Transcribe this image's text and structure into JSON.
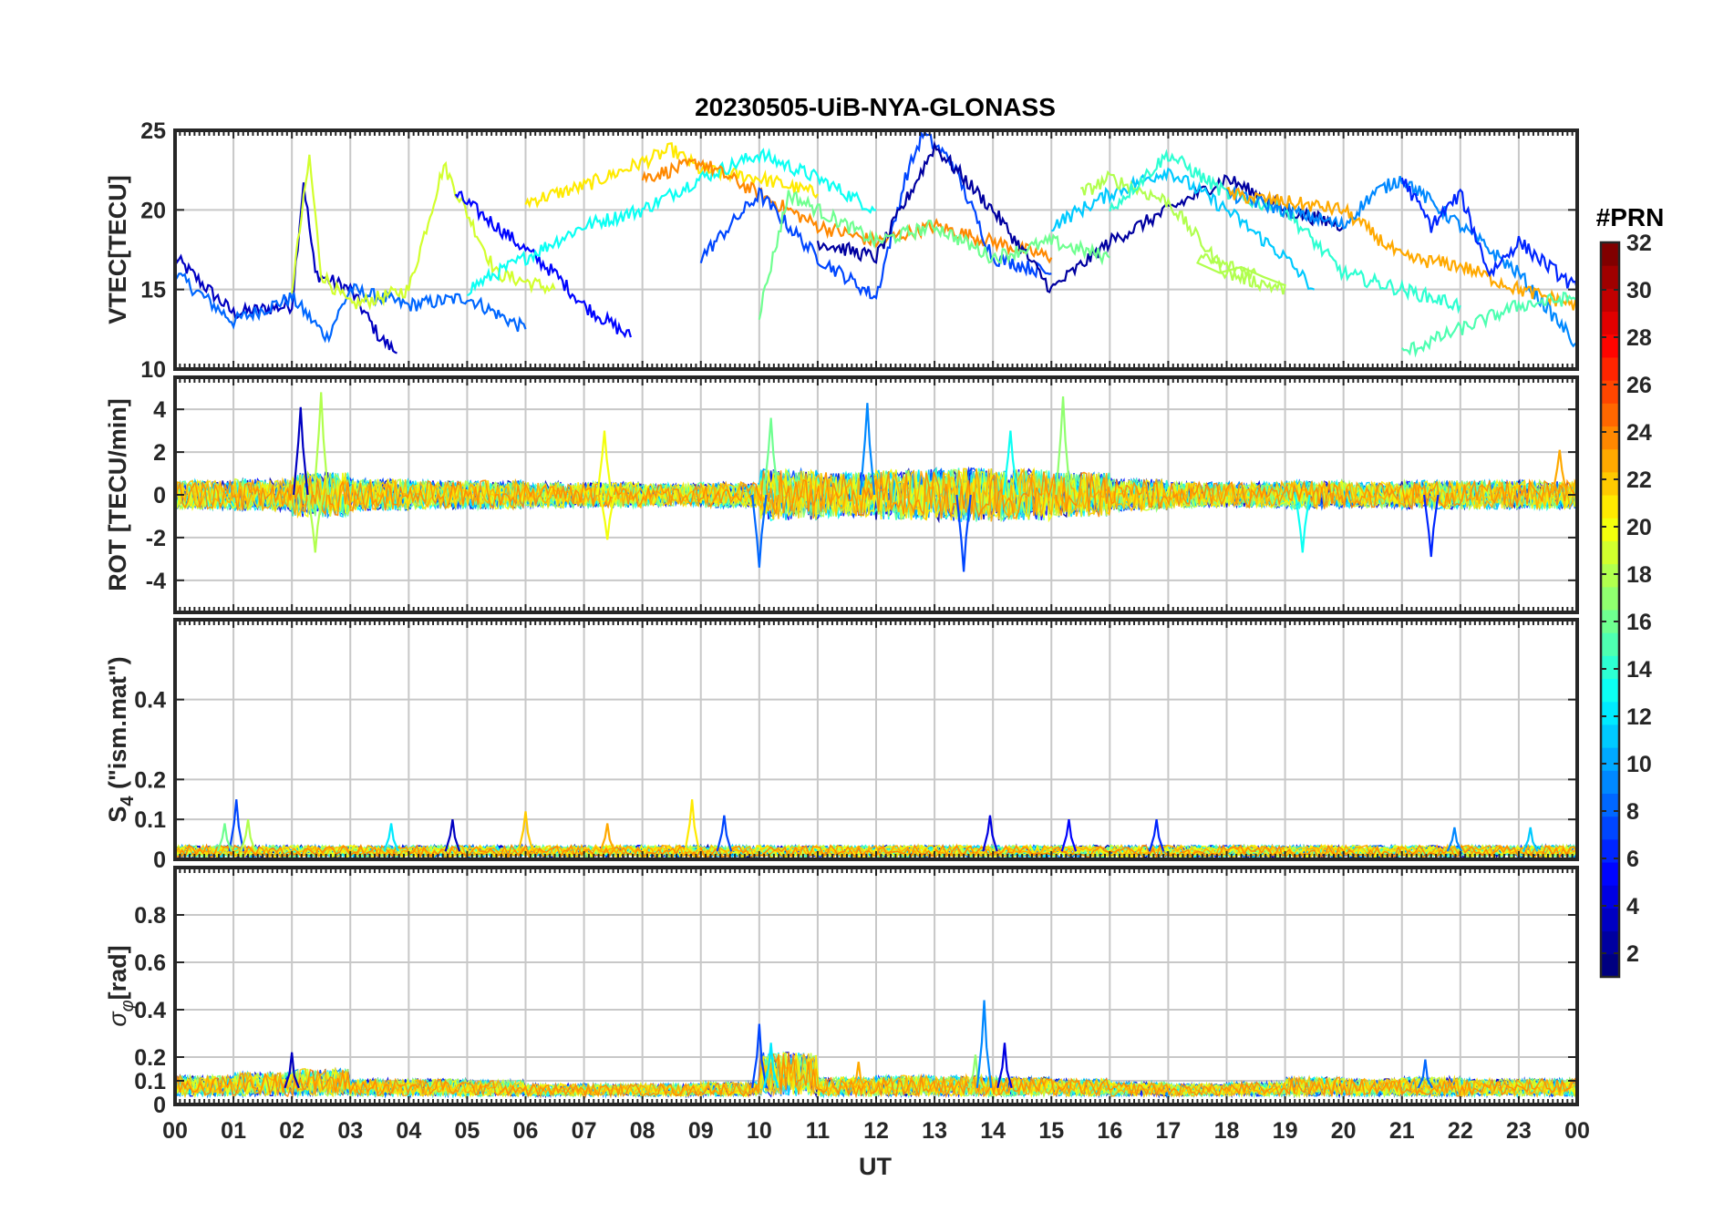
{
  "chart_data": {
    "title": "20230505-UiB-NYA-GLONASS",
    "type": "line",
    "x_axis": {
      "label": "UT",
      "ticks": [
        "00",
        "01",
        "02",
        "03",
        "04",
        "05",
        "06",
        "07",
        "08",
        "09",
        "10",
        "11",
        "12",
        "13",
        "14",
        "15",
        "16",
        "17",
        "18",
        "19",
        "20",
        "21",
        "22",
        "23",
        "00"
      ],
      "range_hours": [
        0,
        24
      ]
    },
    "grid": true,
    "color_by": "PRN",
    "colorbar": {
      "title": "#PRN",
      "colormap": "jet",
      "range": [
        1,
        32
      ],
      "levels": 32,
      "placement": "right",
      "ticks": [
        "2",
        "4",
        "6",
        "8",
        "10",
        "12",
        "14",
        "16",
        "18",
        "20",
        "22",
        "24",
        "26",
        "28",
        "30",
        "32"
      ]
    },
    "panels": [
      {
        "id": "vtec",
        "ylabel": "VTEC[TECU]",
        "ylim": [
          10,
          25
        ],
        "yticks": [
          "10",
          "15",
          "20",
          "25"
        ],
        "ytick_values": [
          10,
          15,
          20,
          25
        ],
        "series": [
          {
            "prn": 3,
            "points": [
              [
                0,
                17
              ],
              [
                1,
                13.5
              ],
              [
                2,
                14
              ],
              [
                2.2,
                21.8
              ],
              [
                2.4,
                16
              ],
              [
                3,
                15
              ],
              [
                3.5,
                12
              ],
              [
                3.8,
                11
              ]
            ]
          },
          {
            "prn": 8,
            "points": [
              [
                0,
                16
              ],
              [
                1,
                13
              ],
              [
                2,
                14.5
              ],
              [
                2.6,
                12
              ],
              [
                3,
                15
              ],
              [
                4,
                14
              ],
              [
                5,
                14.5
              ],
              [
                6,
                12.5
              ]
            ]
          },
          {
            "prn": 19,
            "points": [
              [
                2,
                15
              ],
              [
                2.3,
                23.3
              ],
              [
                2.5,
                16
              ],
              [
                3,
                14
              ],
              [
                4,
                15
              ],
              [
                4.6,
                22.8
              ],
              [
                5.5,
                16
              ],
              [
                6.5,
                15
              ]
            ]
          },
          {
            "prn": 5,
            "points": [
              [
                4.8,
                21
              ],
              [
                5.5,
                19
              ],
              [
                6.5,
                16
              ],
              [
                7,
                14
              ],
              [
                7.8,
                12
              ]
            ]
          },
          {
            "prn": 21,
            "points": [
              [
                6,
                20.5
              ],
              [
                7,
                21.5
              ],
              [
                8,
                23
              ],
              [
                8.5,
                23.8
              ],
              [
                9,
                22.5
              ],
              [
                10,
                22
              ],
              [
                11,
                21
              ]
            ]
          },
          {
            "prn": 13,
            "points": [
              [
                5,
                15
              ],
              [
                6,
                17
              ],
              [
                7,
                19
              ],
              [
                8,
                20
              ],
              [
                9,
                22
              ],
              [
                10,
                23.5
              ],
              [
                11,
                22
              ],
              [
                12,
                20
              ]
            ]
          },
          {
            "prn": 24,
            "points": [
              [
                8,
                22
              ],
              [
                9,
                23
              ],
              [
                10,
                21
              ],
              [
                11,
                19
              ],
              [
                12,
                18
              ],
              [
                13,
                19
              ],
              [
                14,
                18
              ],
              [
                15,
                17
              ]
            ]
          },
          {
            "prn": 7,
            "points": [
              [
                9,
                17
              ],
              [
                10,
                21
              ],
              [
                11,
                17
              ],
              [
                12,
                14.5
              ],
              [
                12.5,
                22
              ],
              [
                12.8,
                24.8
              ],
              [
                13.3,
                23
              ],
              [
                14,
                17
              ],
              [
                15,
                16
              ]
            ]
          },
          {
            "prn": 2,
            "points": [
              [
                11,
                18
              ],
              [
                12,
                17
              ],
              [
                13,
                24
              ],
              [
                14,
                20
              ],
              [
                15,
                15
              ],
              [
                16,
                18
              ],
              [
                17,
                20
              ],
              [
                18,
                22
              ],
              [
                19,
                20
              ],
              [
                20,
                19
              ]
            ]
          },
          {
            "prn": 16,
            "points": [
              [
                10,
                13.5
              ],
              [
                10.5,
                21
              ],
              [
                11,
                20
              ],
              [
                12,
                18
              ],
              [
                13,
                19
              ],
              [
                14,
                17
              ],
              [
                15,
                18
              ],
              [
                16,
                17
              ]
            ]
          },
          {
            "prn": 11,
            "points": [
              [
                15,
                19
              ],
              [
                16,
                21
              ],
              [
                17,
                22.5
              ],
              [
                18,
                20
              ],
              [
                19,
                17
              ],
              [
                19.5,
                15
              ]
            ]
          },
          {
            "prn": 18,
            "points": [
              [
                15.5,
                21
              ],
              [
                16,
                22
              ],
              [
                17,
                20.5
              ],
              [
                18,
                16
              ],
              [
                19,
                15
              ],
              [
                17.5,
                17
              ],
              [
                18.5,
                16
              ]
            ]
          },
          {
            "prn": 14,
            "points": [
              [
                16,
                20
              ],
              [
                17,
                23.5
              ],
              [
                18,
                21
              ],
              [
                19,
                20
              ],
              [
                20,
                16
              ],
              [
                21,
                15
              ],
              [
                22,
                14
              ]
            ]
          },
          {
            "prn": 9,
            "points": [
              [
                18,
                21
              ],
              [
                19,
                20
              ],
              [
                20,
                19
              ],
              [
                20.5,
                21
              ],
              [
                21,
                22
              ],
              [
                22,
                19
              ],
              [
                23,
                16
              ],
              [
                24,
                11.5
              ]
            ]
          },
          {
            "prn": 23,
            "points": [
              [
                18,
                21
              ],
              [
                19,
                20.5
              ],
              [
                20,
                20
              ],
              [
                21,
                17
              ],
              [
                22,
                16.5
              ],
              [
                23,
                15
              ],
              [
                24,
                14
              ]
            ]
          },
          {
            "prn": 15,
            "points": [
              [
                21,
                11
              ],
              [
                22,
                12.5
              ],
              [
                23,
                14
              ],
              [
                24,
                14.5
              ]
            ]
          },
          {
            "prn": 6,
            "points": [
              [
                21,
                22
              ],
              [
                21.5,
                19
              ],
              [
                22,
                21
              ],
              [
                22.5,
                16
              ],
              [
                23,
                18
              ],
              [
                24,
                15
              ]
            ]
          }
        ]
      },
      {
        "id": "rot",
        "ylabel": "ROT [TECU/min]",
        "ylim": [
          -5.5,
          5.5
        ],
        "yticks": [
          "-4",
          "-2",
          "0",
          "2",
          "4"
        ],
        "ytick_values": [
          -4,
          -2,
          0,
          2,
          4
        ],
        "envelope_by_hour": [
          0.9,
          1.0,
          1.4,
          1.0,
          0.9,
          0.9,
          0.8,
          0.8,
          0.7,
          0.8,
          1.6,
          1.4,
          1.6,
          1.7,
          1.6,
          1.4,
          1.0,
          0.8,
          0.8,
          0.9,
          0.8,
          0.9,
          0.9,
          0.9,
          0.8
        ],
        "spikes": [
          {
            "t": 2.15,
            "v": 4.1,
            "prn": 3
          },
          {
            "t": 2.5,
            "v": 4.8,
            "prn": 18
          },
          {
            "t": 2.4,
            "v": -2.7,
            "prn": 18
          },
          {
            "t": 7.35,
            "v": 3.0,
            "prn": 20
          },
          {
            "t": 7.4,
            "v": -2.1,
            "prn": 20
          },
          {
            "t": 10.0,
            "v": -3.4,
            "prn": 8
          },
          {
            "t": 10.2,
            "v": 3.6,
            "prn": 16
          },
          {
            "t": 11.85,
            "v": 4.3,
            "prn": 9
          },
          {
            "t": 13.5,
            "v": -3.6,
            "prn": 7
          },
          {
            "t": 14.3,
            "v": 3.0,
            "prn": 13
          },
          {
            "t": 15.2,
            "v": 4.6,
            "prn": 17
          },
          {
            "t": 19.3,
            "v": -2.7,
            "prn": 13
          },
          {
            "t": 21.5,
            "v": -2.9,
            "prn": 6
          },
          {
            "t": 23.7,
            "v": 2.1,
            "prn": 23
          }
        ]
      },
      {
        "id": "s4",
        "ylabel_main": "S",
        "ylabel_sub": "4",
        "ylabel_rest": " (\"ism.mat\")",
        "ylim": [
          0,
          0.6
        ],
        "yticks": [
          "0",
          "0.1",
          "0.2",
          "0.4"
        ],
        "ytick_values": [
          0,
          0.1,
          0.2,
          0.4
        ],
        "baseline": 0.02,
        "spikes": [
          {
            "t": 1.05,
            "v": 0.15,
            "prn": 7
          },
          {
            "t": 0.85,
            "v": 0.09,
            "prn": 16
          },
          {
            "t": 1.25,
            "v": 0.1,
            "prn": 18
          },
          {
            "t": 3.7,
            "v": 0.09,
            "prn": 12
          },
          {
            "t": 4.75,
            "v": 0.1,
            "prn": 3
          },
          {
            "t": 6.0,
            "v": 0.12,
            "prn": 22
          },
          {
            "t": 7.4,
            "v": 0.09,
            "prn": 23
          },
          {
            "t": 8.85,
            "v": 0.15,
            "prn": 21
          },
          {
            "t": 9.4,
            "v": 0.11,
            "prn": 7
          },
          {
            "t": 13.95,
            "v": 0.11,
            "prn": 4
          },
          {
            "t": 15.3,
            "v": 0.1,
            "prn": 5
          },
          {
            "t": 16.8,
            "v": 0.1,
            "prn": 6
          },
          {
            "t": 21.9,
            "v": 0.08,
            "prn": 9
          },
          {
            "t": 23.2,
            "v": 0.08,
            "prn": 11
          }
        ]
      },
      {
        "id": "sigma_phi",
        "ylabel_main": "σ",
        "ylabel_sub": "φ",
        "ylabel_rest": "[rad]",
        "ylim": [
          0,
          1.0
        ],
        "yticks": [
          "0",
          "0.1",
          "0.2",
          "0.4",
          "0.6",
          "0.8"
        ],
        "ytick_values": [
          0,
          0.1,
          0.2,
          0.4,
          0.6,
          0.8
        ],
        "baseline": 0.07,
        "envelope_by_hour": [
          0.16,
          0.18,
          0.2,
          0.14,
          0.14,
          0.13,
          0.11,
          0.11,
          0.11,
          0.12,
          0.3,
          0.15,
          0.16,
          0.16,
          0.15,
          0.14,
          0.12,
          0.11,
          0.12,
          0.15,
          0.14,
          0.15,
          0.14,
          0.14,
          0.13
        ],
        "spikes": [
          {
            "t": 2.0,
            "v": 0.22,
            "prn": 3
          },
          {
            "t": 10.0,
            "v": 0.34,
            "prn": 7
          },
          {
            "t": 10.2,
            "v": 0.26,
            "prn": 12
          },
          {
            "t": 11.7,
            "v": 0.18,
            "prn": 23
          },
          {
            "t": 13.7,
            "v": 0.21,
            "prn": 17
          },
          {
            "t": 13.85,
            "v": 0.44,
            "prn": 9
          },
          {
            "t": 14.2,
            "v": 0.26,
            "prn": 4
          },
          {
            "t": 21.4,
            "v": 0.19,
            "prn": 8
          }
        ]
      }
    ]
  }
}
